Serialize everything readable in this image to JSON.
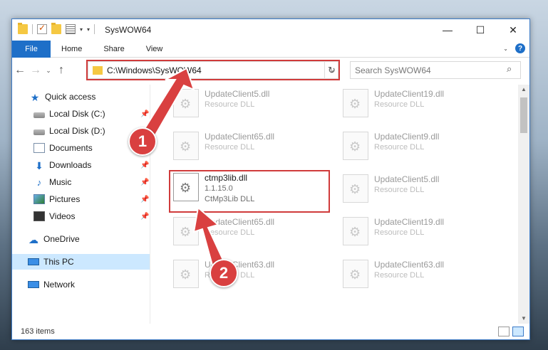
{
  "window": {
    "title": "SysWOW64"
  },
  "ribbon": {
    "tabs": [
      "File",
      "Home",
      "Share",
      "View"
    ]
  },
  "address": {
    "path": "C:\\Windows\\SysWOW64"
  },
  "search": {
    "placeholder": "Search SysWOW64"
  },
  "sidebar": {
    "items": [
      {
        "label": "Quick access",
        "icon": "star-icon"
      },
      {
        "label": "Local Disk (C:)",
        "icon": "disk-icon"
      },
      {
        "label": "Local Disk (D:)",
        "icon": "disk-icon"
      },
      {
        "label": "Documents",
        "icon": "document-icon"
      },
      {
        "label": "Downloads",
        "icon": "download-icon"
      },
      {
        "label": "Music",
        "icon": "music-icon"
      },
      {
        "label": "Pictures",
        "icon": "pictures-icon"
      },
      {
        "label": "Videos",
        "icon": "video-icon"
      },
      {
        "label": "OneDrive",
        "icon": "cloud-icon"
      },
      {
        "label": "This PC",
        "icon": "computer-icon"
      },
      {
        "label": "Network",
        "icon": "network-icon"
      }
    ]
  },
  "files": [
    {
      "name": "UpdateClient5.dll",
      "type": "Resource DLL"
    },
    {
      "name": "UpdateClient19.dll",
      "type": "Resource DLL"
    },
    {
      "name": "UpdateClient65.dll",
      "type": "Resource DLL"
    },
    {
      "name": "UpdateClient9.dll",
      "type": "Resource DLL"
    },
    {
      "name": "ctmp3lib.dll",
      "version": "1.1.15.0",
      "type": "CtMp3Lib DLL"
    },
    {
      "name": "UpdateClient5.dll",
      "type": "Resource DLL"
    },
    {
      "name": "UpdateClient65.dll",
      "type": "Resource DLL"
    },
    {
      "name": "UpdateClient19.dll",
      "type": "Resource DLL"
    },
    {
      "name": "UpdateClient63.dll",
      "type": "Resource DLL"
    },
    {
      "name": "UpdateClient63.dll",
      "type": "Resource DLL"
    }
  ],
  "status": {
    "count": "163 items"
  },
  "annotations": {
    "step1": "1",
    "step2": "2",
    "color": "#d94040"
  }
}
